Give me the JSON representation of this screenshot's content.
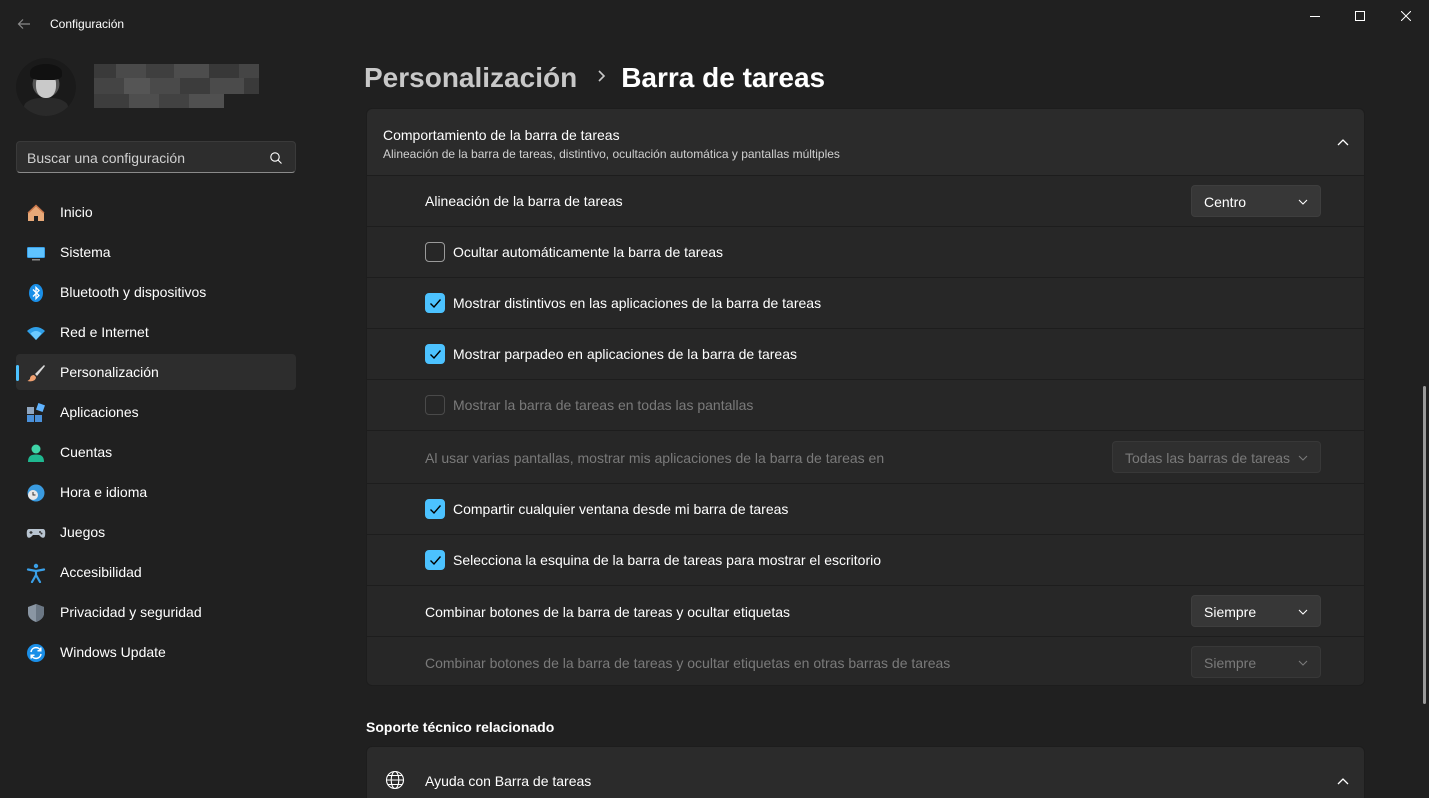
{
  "window": {
    "title": "Configuración",
    "back_icon": "back-arrow-icon",
    "controls": [
      "minimize-icon",
      "maximize-icon",
      "close-icon"
    ]
  },
  "sidebar": {
    "search": {
      "placeholder": "Buscar una configuración",
      "value": ""
    },
    "items": [
      {
        "label": "Inicio",
        "icon": "home-icon"
      },
      {
        "label": "Sistema",
        "icon": "monitor-icon"
      },
      {
        "label": "Bluetooth y dispositivos",
        "icon": "bluetooth-icon"
      },
      {
        "label": "Red e Internet",
        "icon": "wifi-icon"
      },
      {
        "label": "Personalización",
        "icon": "brush-icon",
        "selected": true
      },
      {
        "label": "Aplicaciones",
        "icon": "apps-icon"
      },
      {
        "label": "Cuentas",
        "icon": "account-icon"
      },
      {
        "label": "Hora e idioma",
        "icon": "clock-globe-icon"
      },
      {
        "label": "Juegos",
        "icon": "gamepad-icon"
      },
      {
        "label": "Accesibilidad",
        "icon": "accessibility-icon"
      },
      {
        "label": "Privacidad y seguridad",
        "icon": "shield-icon"
      },
      {
        "label": "Windows Update",
        "icon": "update-icon"
      }
    ]
  },
  "breadcrumb": {
    "parent": "Personalización",
    "current": "Barra de tareas"
  },
  "behavior_card": {
    "title": "Comportamiento de la barra de tareas",
    "subtitle": "Alineación de la barra de tareas, distintivo, ocultación automática y pantallas múltiples",
    "rows": [
      {
        "label": "Alineación de la barra de tareas",
        "type": "dropdown",
        "value": "Centro"
      },
      {
        "label": "Ocultar automáticamente la barra de tareas",
        "type": "checkbox",
        "checked": false
      },
      {
        "label": "Mostrar distintivos en las aplicaciones de la barra de tareas",
        "type": "checkbox",
        "checked": true
      },
      {
        "label": "Mostrar parpadeo en aplicaciones de la barra de tareas",
        "type": "checkbox",
        "checked": true
      },
      {
        "label": "Mostrar la barra de tareas en todas las pantallas",
        "type": "checkbox",
        "checked": false,
        "disabled": true
      },
      {
        "label": "Al usar varias pantallas, mostrar mis aplicaciones de la barra de tareas en",
        "type": "dropdown",
        "value": "Todas las barras de tareas",
        "disabled": true
      },
      {
        "label": "Compartir cualquier ventana desde mi barra de tareas",
        "type": "checkbox",
        "checked": true
      },
      {
        "label": "Selecciona la esquina de la barra de tareas para mostrar el escritorio",
        "type": "checkbox",
        "checked": true
      },
      {
        "label": "Combinar botones de la barra de tareas y ocultar etiquetas",
        "type": "dropdown",
        "value": "Siempre"
      },
      {
        "label": "Combinar botones de la barra de tareas y ocultar etiquetas en otras barras de tareas",
        "type": "dropdown",
        "value": "Siempre",
        "disabled": true
      }
    ]
  },
  "related_support": {
    "title": "Soporte técnico relacionado",
    "help_item": {
      "label": "Ayuda con Barra de tareas",
      "icon": "globe-icon"
    }
  },
  "colors": {
    "accent": "#4cc2ff",
    "background": "#202020",
    "card": "#272727"
  }
}
